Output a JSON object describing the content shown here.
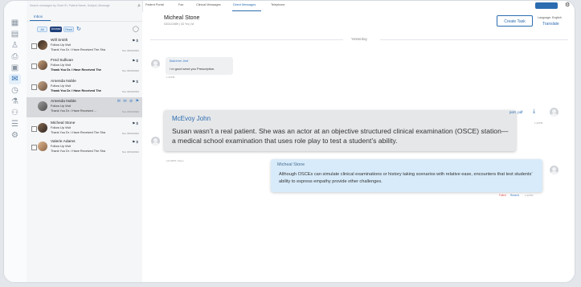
{
  "inbox": {
    "search_placeholder": "Search messages by Chart ID, Patient Name, Subject, Message",
    "tab_label": "Inbox",
    "filters": {
      "all": "All",
      "unread": "Unread",
      "read": "Read"
    },
    "items": [
      {
        "name": "Will Smith",
        "subject": "Follow Up Visit",
        "message": "Thank You Dr. I Have Received The Sha",
        "date": "Nov 30/04/2022",
        "flags": "⚑ $",
        "unread": false
      },
      {
        "name": "Fred Sullivan",
        "subject": "Follow Up Visit",
        "message": "Thank You Dr. I Have Received The",
        "date": "Nov 30/04/2022",
        "flags": "⚑ $",
        "unread": true
      },
      {
        "name": "Amenda Noble",
        "subject": "Follow Up Visit",
        "message": "Thank You Dr. I Have Received The",
        "date": "Nov 30/04/2022",
        "flags": "⚑ $",
        "unread": true
      },
      {
        "name": "Amenda Noble",
        "subject": "Follow Up Visit",
        "message": "Thank You Dr. I Have Received ...",
        "date": "Nov 30/04/2022",
        "flags": "✉ ✉ ⊘ ⚑",
        "unread": false,
        "selected": true
      },
      {
        "name": "Micheal Stone",
        "subject": "Follow Up Visit",
        "message": "Thank You Dr. I Have Received The Sha",
        "date": "Nov 30/04/2022",
        "flags": "⚑ $",
        "unread": false
      },
      {
        "name": "Valerie Adams",
        "subject": "Follow Up Visit",
        "message": "Thank You Dr. I Have Received The Sha",
        "date": "Nov 30/04/2022",
        "flags": "⚑ $",
        "unread": false
      }
    ]
  },
  "top_tabs": [
    "Patient Portal",
    "Fax",
    "Clinical Messages",
    "Direct Messages",
    "Telephone"
  ],
  "conversation": {
    "patient_name": "Micheal Stone",
    "patient_meta": "03/31/1989 | 33 Yrs | M",
    "create_task": "Create Task",
    "language_label": "Language: English",
    "translate": "Translate",
    "date_separator": "Yesterday",
    "messages": [
      {
        "sender": "Bakrimer Jedi",
        "text": "I m good send you Prescription.",
        "time": "1:22PM"
      },
      {
        "sender": "McEvoy John",
        "text": "Susan wasn’t a real patient. She was an actor at an objective structured clinical examination (OSCE) station—a medical school examination that uses role play to test a student’s ability.",
        "time": "12:22PM | Seen"
      },
      {
        "attachment": "port. pdf",
        "time": "1:22PM"
      },
      {
        "sender": "Micheal Stone",
        "text": "Although OSCEs can simulate clinical examinations or history taking scenarios with relative ease, encounters that test students’ ability to express empathy provide other challenges.",
        "status": "Failed",
        "resend": "Resend",
        "time": "1:22PM"
      }
    ]
  }
}
